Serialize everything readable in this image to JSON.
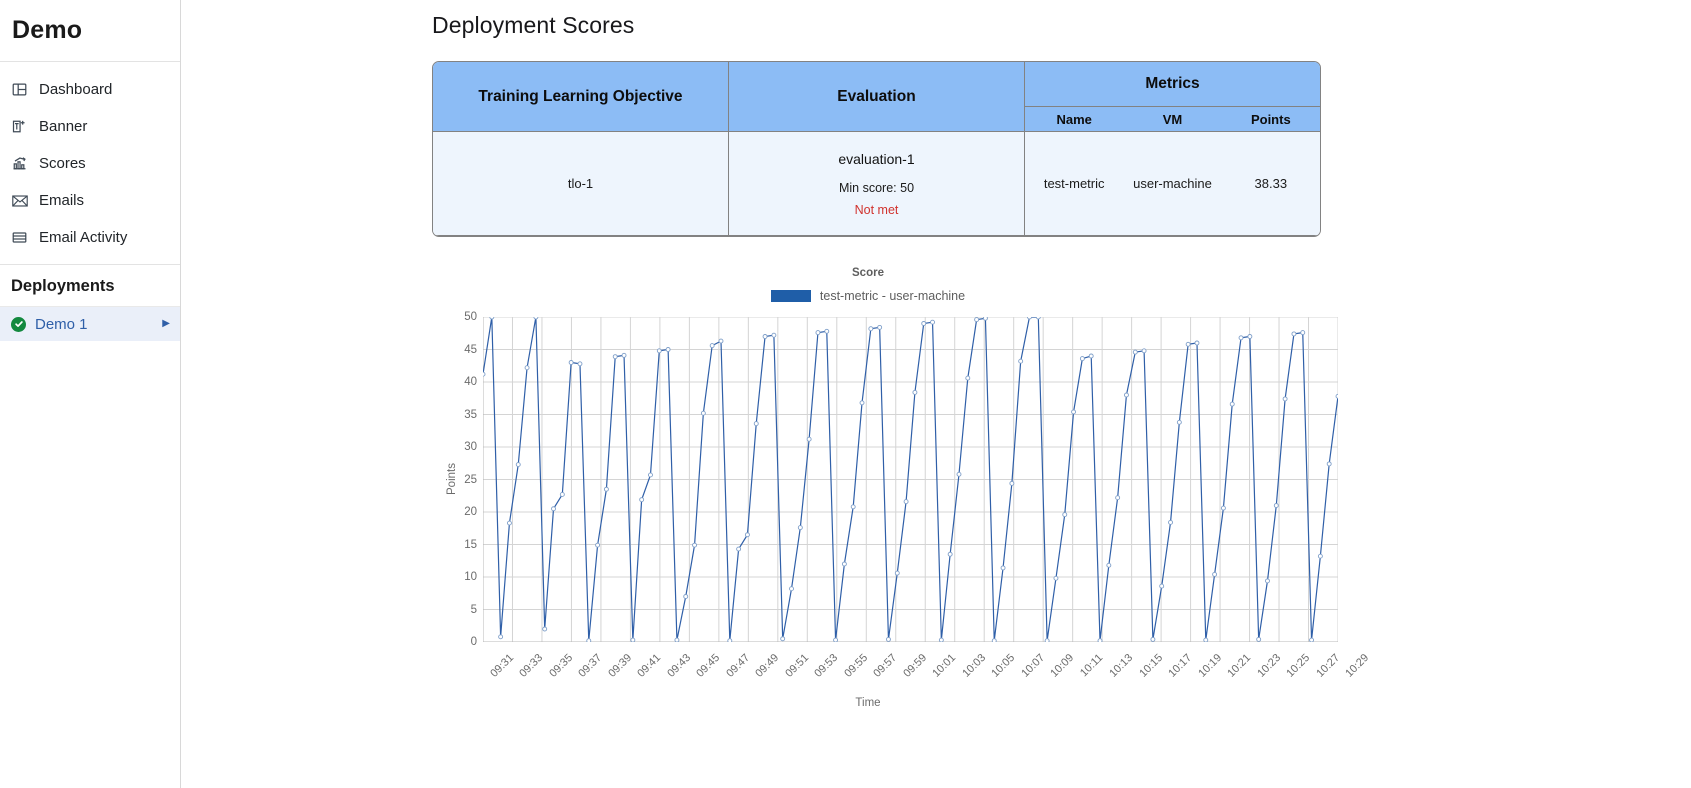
{
  "sidebar": {
    "brand": "Demo",
    "items": [
      {
        "label": "Dashboard",
        "icon": "dashboard-icon"
      },
      {
        "label": "Banner",
        "icon": "banner-icon"
      },
      {
        "label": "Scores",
        "icon": "scores-icon"
      },
      {
        "label": "Emails",
        "icon": "envelope-icon"
      },
      {
        "label": "Email Activity",
        "icon": "list-icon"
      }
    ],
    "section_title": "Deployments",
    "deployments": [
      {
        "label": "Demo 1",
        "status_icon": "check-circle-icon",
        "expand_icon": "chevron-right-icon"
      }
    ]
  },
  "main": {
    "page_title": "Deployment Scores"
  },
  "table": {
    "headers": {
      "tlo": "Training Learning Objective",
      "evaluation": "Evaluation",
      "metrics": "Metrics",
      "metric_name": "Name",
      "metric_vm": "VM",
      "metric_points": "Points"
    },
    "rows": [
      {
        "tlo": "tlo-1",
        "evaluation_name": "evaluation-1",
        "evaluation_min": "Min score: 50",
        "evaluation_status": "Not met",
        "status_color": "#d1332e",
        "metric_name": "test-metric",
        "metric_vm": "user-machine",
        "metric_points": "38.33"
      }
    ]
  },
  "chart_data": {
    "type": "line",
    "title": "Score",
    "xlabel": "Time",
    "ylabel": "Points",
    "ylim": [
      0,
      50
    ],
    "yticks": [
      0,
      5,
      10,
      15,
      20,
      25,
      30,
      35,
      40,
      45,
      50
    ],
    "grid": true,
    "legend_position": "top",
    "line_color": "#2f5fa8",
    "legend": [
      "test-metric - user-machine"
    ],
    "series": [
      {
        "name": "test-metric - user-machine",
        "values": [
          41.2,
          50.0,
          0.8,
          18.3,
          27.3,
          42.2,
          50.0,
          2.0,
          20.5,
          22.7,
          43.0,
          42.8,
          0.2,
          14.9,
          23.5,
          43.9,
          44.1,
          0.3,
          21.9,
          25.7,
          44.8,
          45.0,
          0.3,
          7.0,
          14.9,
          35.2,
          45.6,
          46.3,
          0.2,
          14.3,
          16.5,
          33.6,
          47.0,
          47.2,
          0.5,
          8.2,
          17.6,
          31.2,
          47.6,
          47.8,
          0.3,
          12.0,
          20.8,
          36.8,
          48.2,
          48.4,
          0.4,
          10.6,
          21.6,
          38.4,
          49.0,
          49.2,
          0.3,
          13.5,
          25.8,
          40.6,
          49.6,
          49.8,
          0.2,
          11.4,
          24.4,
          43.2,
          50.0,
          50.0,
          0.2,
          9.8,
          19.6,
          35.4,
          43.6,
          44.0,
          0.2,
          11.8,
          22.2,
          38.0,
          44.6,
          44.8,
          0.4,
          8.6,
          18.4,
          33.8,
          45.8,
          46.0,
          0.3,
          10.4,
          20.6,
          36.6,
          46.8,
          47.0,
          0.4,
          9.4,
          21.0,
          37.4,
          47.4,
          47.6,
          0.3,
          13.2,
          27.4,
          37.8
        ]
      }
    ],
    "xticks": [
      "09:31",
      "09:33",
      "09:35",
      "09:37",
      "09:39",
      "09:41",
      "09:43",
      "09:45",
      "09:47",
      "09:49",
      "09:51",
      "09:53",
      "09:55",
      "09:57",
      "09:59",
      "10:01",
      "10:03",
      "10:05",
      "10:07",
      "10:09",
      "10:11",
      "10:13",
      "10:15",
      "10:17",
      "10:19",
      "10:21",
      "10:23",
      "10:25",
      "10:27",
      "10:29"
    ]
  }
}
